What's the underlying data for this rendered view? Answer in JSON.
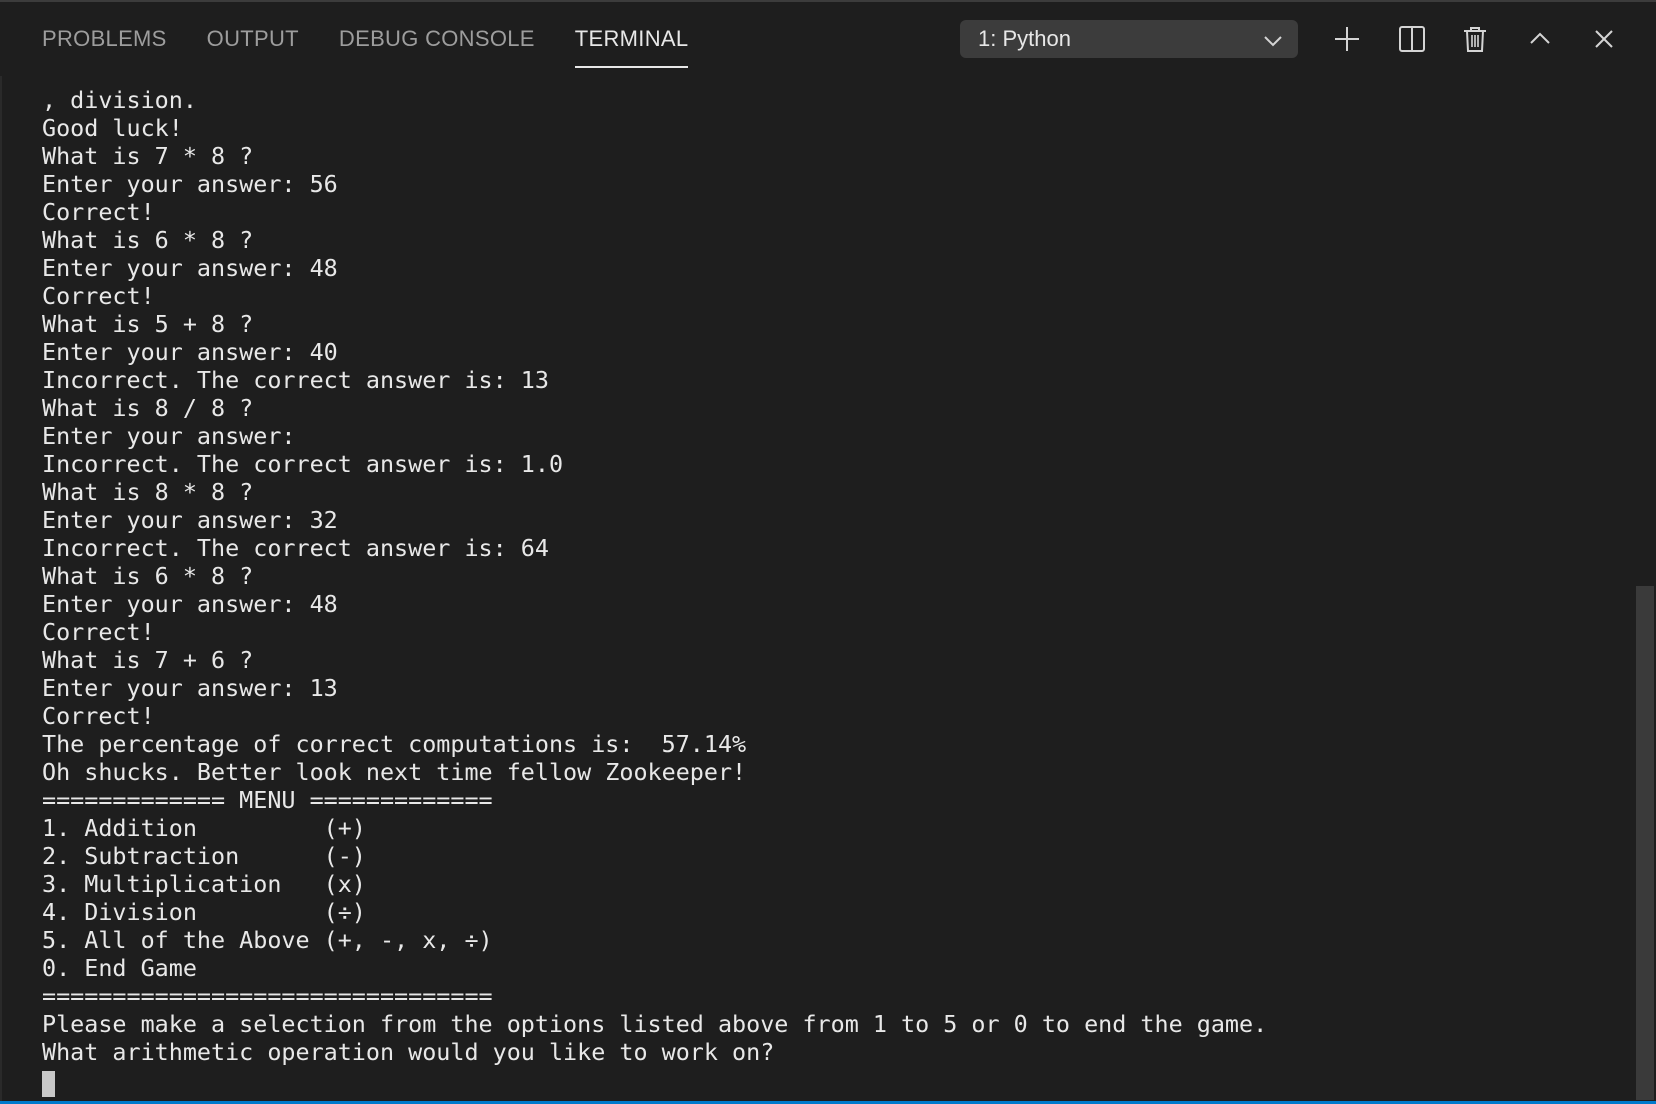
{
  "panel": {
    "tabs": [
      {
        "label": "PROBLEMS",
        "active": false
      },
      {
        "label": "OUTPUT",
        "active": false
      },
      {
        "label": "DEBUG CONSOLE",
        "active": false
      },
      {
        "label": "TERMINAL",
        "active": true
      }
    ],
    "terminal_select": {
      "selected": "1: Python"
    },
    "actions": [
      {
        "icon": "plus-icon"
      },
      {
        "icon": "split-icon"
      },
      {
        "icon": "trash-icon"
      },
      {
        "icon": "chevron-up-icon"
      },
      {
        "icon": "close-icon"
      }
    ]
  },
  "terminal": {
    "lines": [
      ", division.",
      "Good luck!",
      "What is 7 * 8 ?",
      "Enter your answer: 56",
      "Correct!",
      "What is 6 * 8 ?",
      "Enter your answer: 48",
      "Correct!",
      "What is 5 + 8 ?",
      "Enter your answer: 40",
      "Incorrect. The correct answer is: 13",
      "What is 8 / 8 ?",
      "Enter your answer:",
      "Incorrect. The correct answer is: 1.0",
      "What is 8 * 8 ?",
      "Enter your answer: 32",
      "Incorrect. The correct answer is: 64",
      "What is 6 * 8 ?",
      "Enter your answer: 48",
      "Correct!",
      "What is 7 + 6 ?",
      "Enter your answer: 13",
      "Correct!",
      "The percentage of correct computations is:  57.14%",
      "Oh shucks. Better look next time fellow Zookeeper!",
      "============= MENU =============",
      "1. Addition         (+)",
      "2. Subtraction      (-)",
      "3. Multiplication   (x)",
      "4. Division         (÷)",
      "5. All of the Above (+, -, x, ÷)",
      "0. End Game",
      "================================",
      "Please make a selection from the options listed above from 1 to 5 or 0 to end the game.",
      "What arithmetic operation would you like to work on?"
    ]
  },
  "colors": {
    "background": "#1e1e1e",
    "text": "#e8e8e8",
    "tab_inactive": "#9d9d9d",
    "tab_active": "#e7e7e7",
    "select_bg": "#3c3c3c",
    "accent": "#007acc"
  }
}
